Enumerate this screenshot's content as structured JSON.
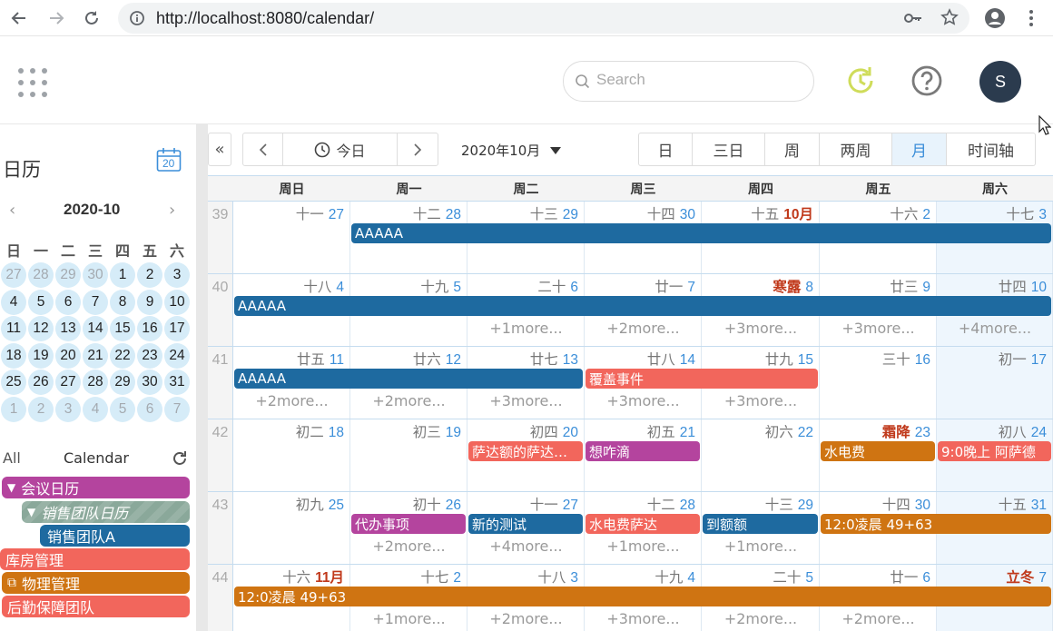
{
  "browser": {
    "url": "http://localhost:8080/calendar/"
  },
  "header": {
    "search_placeholder": "Search",
    "avatar_initial": "S"
  },
  "sidebar": {
    "title": "日历",
    "date_icon_day": "20",
    "mini": {
      "month": "2020-10",
      "prev": "‹",
      "next": "›",
      "weekdays": [
        "日",
        "一",
        "二",
        "三",
        "四",
        "五",
        "六"
      ],
      "days": [
        {
          "d": "27",
          "other": true
        },
        {
          "d": "28",
          "other": true
        },
        {
          "d": "29",
          "other": true
        },
        {
          "d": "30",
          "other": true
        },
        {
          "d": "1"
        },
        {
          "d": "2"
        },
        {
          "d": "3"
        },
        {
          "d": "4"
        },
        {
          "d": "5"
        },
        {
          "d": "6"
        },
        {
          "d": "7"
        },
        {
          "d": "8"
        },
        {
          "d": "9"
        },
        {
          "d": "10"
        },
        {
          "d": "11"
        },
        {
          "d": "12"
        },
        {
          "d": "13"
        },
        {
          "d": "14"
        },
        {
          "d": "15"
        },
        {
          "d": "16"
        },
        {
          "d": "17"
        },
        {
          "d": "18"
        },
        {
          "d": "19"
        },
        {
          "d": "20"
        },
        {
          "d": "21"
        },
        {
          "d": "22"
        },
        {
          "d": "23"
        },
        {
          "d": "24"
        },
        {
          "d": "25"
        },
        {
          "d": "26"
        },
        {
          "d": "27"
        },
        {
          "d": "28"
        },
        {
          "d": "29"
        },
        {
          "d": "30"
        },
        {
          "d": "31"
        },
        {
          "d": "1",
          "other": true
        },
        {
          "d": "2",
          "other": true
        },
        {
          "d": "3",
          "other": true
        },
        {
          "d": "4",
          "other": true
        },
        {
          "d": "5",
          "other": true
        },
        {
          "d": "6",
          "other": true
        },
        {
          "d": "7",
          "other": true
        }
      ]
    },
    "tab_all": "All",
    "tab_calendar": "Calendar",
    "calendars": [
      {
        "label": "会议日历",
        "color": "#b4449e",
        "icon": "caret-down",
        "indent": 0
      },
      {
        "label": "销售团队日历",
        "color": "#8aa89a",
        "icon": "caret-down",
        "indent": 1,
        "italic": true
      },
      {
        "label": "销售团队A",
        "color": "#1e6aa0",
        "icon": "",
        "indent": 2
      },
      {
        "label": "库房管理",
        "color": "#f2665c",
        "icon": "",
        "indent": 0
      },
      {
        "label": "物理管理",
        "color": "#cf7412",
        "icon": "copy",
        "indent": 0
      },
      {
        "label": "后勤保障团队",
        "color": "#f2665c",
        "icon": "",
        "indent": 0
      }
    ]
  },
  "toolbar": {
    "today": "今日",
    "month_label": "2020年10月",
    "views": [
      "日",
      "三日",
      "周",
      "两周",
      "月",
      "时间轴"
    ],
    "active_view": "月"
  },
  "grid": {
    "weekdays": [
      "周日",
      "周一",
      "周二",
      "周三",
      "周四",
      "周五",
      "周六"
    ],
    "weeks": [
      {
        "num": "39",
        "days": [
          {
            "lunar": "十一",
            "d": "27"
          },
          {
            "lunar": "十二",
            "d": "28"
          },
          {
            "lunar": "十三",
            "d": "29"
          },
          {
            "lunar": "十四",
            "d": "30"
          },
          {
            "lunar": "十五",
            "d": "10月",
            "mstart": true
          },
          {
            "lunar": "十六",
            "d": "2"
          },
          {
            "lunar": "十七",
            "d": "3"
          }
        ],
        "events": [
          {
            "label": "AAAAA",
            "start": 1,
            "span": 6,
            "color": "#1e6aa0",
            "row": 0
          }
        ],
        "more": []
      },
      {
        "num": "40",
        "days": [
          {
            "lunar": "十八",
            "d": "4"
          },
          {
            "lunar": "十九",
            "d": "5"
          },
          {
            "lunar": "二十",
            "d": "6"
          },
          {
            "lunar": "廿一",
            "d": "7"
          },
          {
            "lunar": "寒露",
            "d": "8",
            "term": true
          },
          {
            "lunar": "廿三",
            "d": "9"
          },
          {
            "lunar": "廿四",
            "d": "10"
          }
        ],
        "events": [
          {
            "label": "AAAAA",
            "start": 0,
            "span": 7,
            "color": "#1e6aa0",
            "row": 0
          }
        ],
        "more": [
          {
            "col": 2,
            "text": "+1more..."
          },
          {
            "col": 3,
            "text": "+2more..."
          },
          {
            "col": 4,
            "text": "+3more..."
          },
          {
            "col": 5,
            "text": "+3more..."
          },
          {
            "col": 6,
            "text": "+4more..."
          }
        ]
      },
      {
        "num": "41",
        "days": [
          {
            "lunar": "廿五",
            "d": "11"
          },
          {
            "lunar": "廿六",
            "d": "12"
          },
          {
            "lunar": "廿七",
            "d": "13"
          },
          {
            "lunar": "廿八",
            "d": "14"
          },
          {
            "lunar": "廿九",
            "d": "15"
          },
          {
            "lunar": "三十",
            "d": "16"
          },
          {
            "lunar": "初一",
            "d": "17"
          }
        ],
        "events": [
          {
            "label": "AAAAA",
            "start": 0,
            "span": 3,
            "color": "#1e6aa0",
            "row": 0
          },
          {
            "label": "覆盖事件",
            "start": 3,
            "span": 2,
            "color": "#f2665c",
            "row": 0
          }
        ],
        "more": [
          {
            "col": 0,
            "text": "+2more..."
          },
          {
            "col": 1,
            "text": "+2more..."
          },
          {
            "col": 2,
            "text": "+3more..."
          },
          {
            "col": 3,
            "text": "+3more..."
          },
          {
            "col": 4,
            "text": "+3more..."
          }
        ]
      },
      {
        "num": "42",
        "days": [
          {
            "lunar": "初二",
            "d": "18"
          },
          {
            "lunar": "初三",
            "d": "19"
          },
          {
            "lunar": "初四",
            "d": "20"
          },
          {
            "lunar": "初五",
            "d": "21"
          },
          {
            "lunar": "初六",
            "d": "22"
          },
          {
            "lunar": "霜降",
            "d": "23",
            "term": true
          },
          {
            "lunar": "初八",
            "d": "24"
          }
        ],
        "events": [
          {
            "label": "萨达额的萨达…",
            "start": 2,
            "span": 1,
            "color": "#f2665c",
            "row": 0
          },
          {
            "label": "想咋滴",
            "start": 3,
            "span": 1,
            "color": "#b4449e",
            "row": 0
          },
          {
            "label": "水电费",
            "start": 5,
            "span": 1,
            "color": "#cf7412",
            "row": 0
          },
          {
            "label": "9:0晚上 阿萨德",
            "start": 6,
            "span": 1,
            "color": "#f2665c",
            "row": 0
          }
        ],
        "more": []
      },
      {
        "num": "43",
        "days": [
          {
            "lunar": "初九",
            "d": "25"
          },
          {
            "lunar": "初十",
            "d": "26"
          },
          {
            "lunar": "十一",
            "d": "27"
          },
          {
            "lunar": "十二",
            "d": "28"
          },
          {
            "lunar": "十三",
            "d": "29"
          },
          {
            "lunar": "十四",
            "d": "30"
          },
          {
            "lunar": "十五",
            "d": "31"
          }
        ],
        "events": [
          {
            "label": "代办事项",
            "start": 1,
            "span": 1,
            "color": "#b4449e",
            "row": 0
          },
          {
            "label": "新的测试",
            "start": 2,
            "span": 1,
            "color": "#1e6aa0",
            "row": 0
          },
          {
            "label": "水电费萨达",
            "start": 3,
            "span": 1,
            "color": "#f2665c",
            "row": 0
          },
          {
            "label": "到额额",
            "start": 4,
            "span": 1,
            "color": "#1e6aa0",
            "row": 0
          },
          {
            "label": "12:0凌晨 49+63",
            "start": 5,
            "span": 2,
            "color": "#cf7412",
            "row": 0
          }
        ],
        "more": [
          {
            "col": 1,
            "text": "+2more..."
          },
          {
            "col": 2,
            "text": "+4more..."
          },
          {
            "col": 3,
            "text": "+1more..."
          },
          {
            "col": 4,
            "text": "+1more..."
          }
        ]
      },
      {
        "num": "44",
        "days": [
          {
            "lunar": "十六",
            "d": "11月",
            "mstart": true
          },
          {
            "lunar": "十七",
            "d": "2"
          },
          {
            "lunar": "十八",
            "d": "3"
          },
          {
            "lunar": "十九",
            "d": "4"
          },
          {
            "lunar": "二十",
            "d": "5"
          },
          {
            "lunar": "廿一",
            "d": "6"
          },
          {
            "lunar": "立冬",
            "d": "7",
            "term": true
          }
        ],
        "events": [
          {
            "label": "12:0凌晨 49+63",
            "start": 0,
            "span": 7,
            "color": "#cf7412",
            "row": 0
          }
        ],
        "more": [
          {
            "col": 1,
            "text": "+1more..."
          },
          {
            "col": 2,
            "text": "+2more..."
          },
          {
            "col": 3,
            "text": "+3more..."
          },
          {
            "col": 4,
            "text": "+2more..."
          },
          {
            "col": 5,
            "text": "+2more..."
          }
        ]
      }
    ]
  }
}
